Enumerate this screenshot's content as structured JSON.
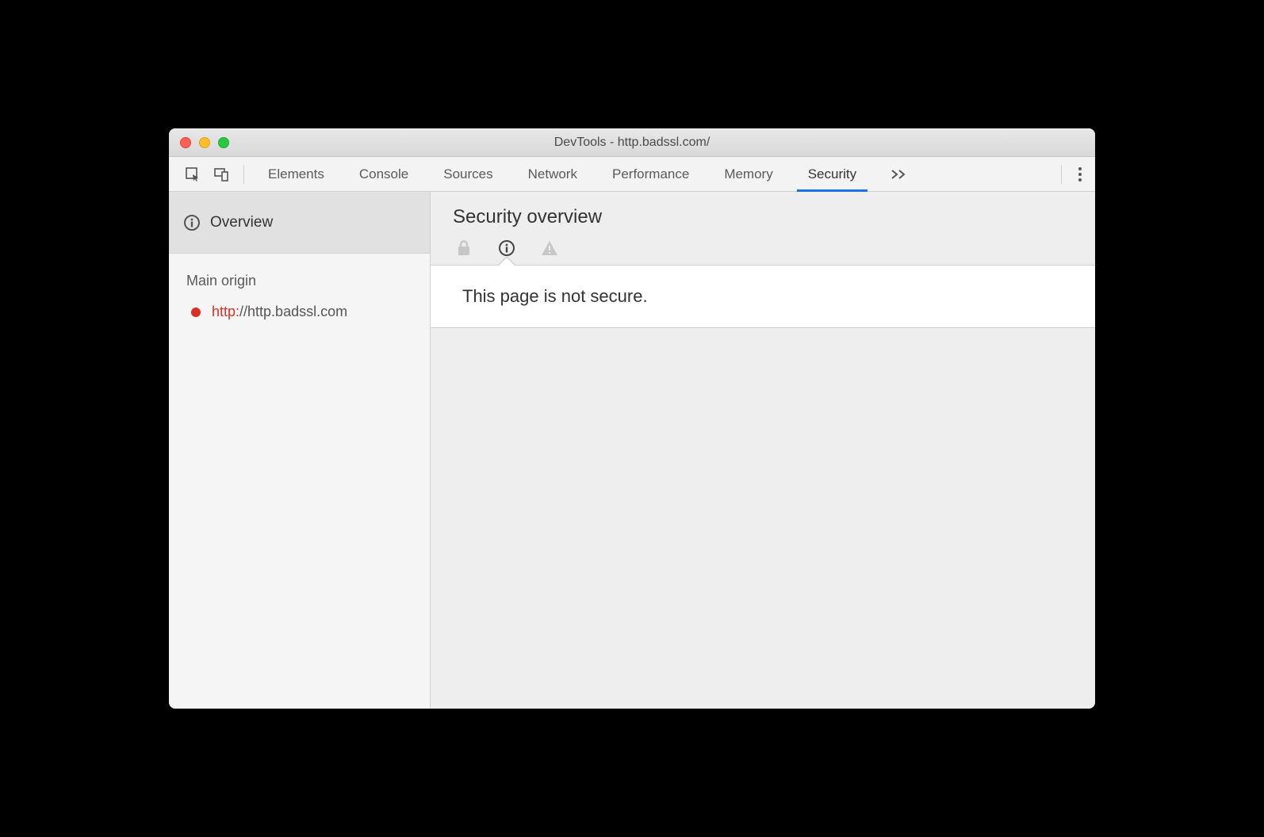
{
  "window": {
    "title": "DevTools - http.badssl.com/"
  },
  "tabs": {
    "items": [
      "Elements",
      "Console",
      "Sources",
      "Network",
      "Performance",
      "Memory",
      "Security"
    ],
    "active": "Security"
  },
  "sidebar": {
    "overview_label": "Overview",
    "section_label": "Main origin",
    "origin": {
      "scheme": "http:",
      "rest": "//http.badssl.com",
      "status_color": "#d93025"
    }
  },
  "main": {
    "title": "Security overview",
    "message": "This page is not secure."
  }
}
